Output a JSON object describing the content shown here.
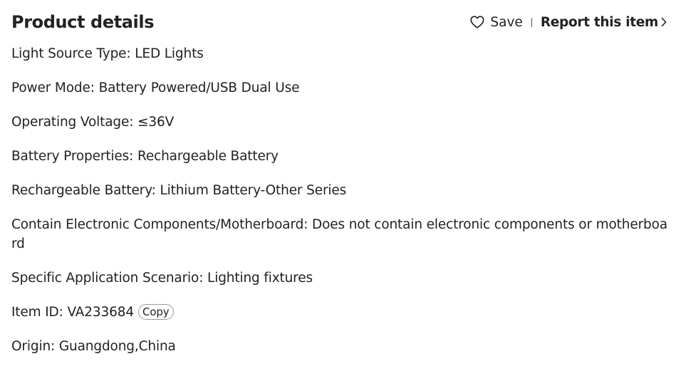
{
  "header": {
    "title": "Product details",
    "save_label": "Save",
    "report_label": "Report this item"
  },
  "icons": {
    "save": "heart-outline-icon",
    "report": "chevron-right-icon"
  },
  "details": [
    {
      "key": "Light Source Type",
      "value": "LED Lights"
    },
    {
      "key": "Power Mode",
      "value": "Battery Powered/USB Dual Use"
    },
    {
      "key": "Operating Voltage",
      "value": "≤36V"
    },
    {
      "key": "Battery Properties",
      "value": "Rechargeable Battery"
    },
    {
      "key": "Rechargeable Battery",
      "value": "Lithium Battery-Other Series"
    },
    {
      "key": "Contain Electronic Components/Motherboard",
      "value": "Does not contain electronic components or motherboard"
    },
    {
      "key": "Specific Application Scenario",
      "value": "Lighting fixtures"
    },
    {
      "key": "Item ID",
      "value": "VA233684",
      "action_label": "Copy"
    },
    {
      "key": "Origin",
      "value": "Guangdong,China"
    }
  ]
}
